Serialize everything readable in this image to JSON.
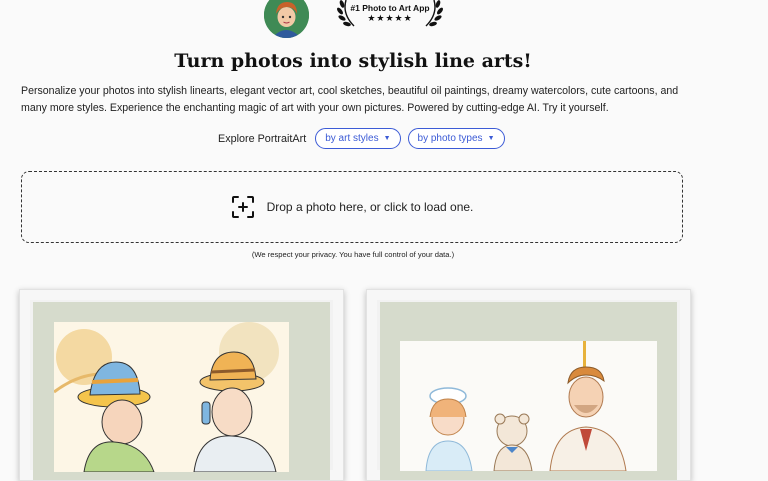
{
  "header": {
    "award_text": "#1 Photo to Art App",
    "award_stars": "★★★★★"
  },
  "hero": {
    "title": "Turn photos into stylish line arts!",
    "description": "Personalize your photos into stylish linearts, elegant vector art, cool sketches, beautiful oil paintings, dreamy watercolors, cute cartoons, and many more styles. Experience the enchanting magic of art with your own pictures. Powered by cutting-edge AI. Try it yourself."
  },
  "explore": {
    "label": "Explore PortraitArt",
    "options": [
      {
        "label": "by art styles"
      },
      {
        "label": "by photo types"
      }
    ]
  },
  "upload": {
    "prompt": "Drop a photo here, or click to load one.",
    "privacy_note": "(We respect your privacy. You have full control of your data.)"
  },
  "colors": {
    "accent": "#3c5bd6",
    "mat": "#d6dbcc"
  },
  "gallery": {
    "items": [
      {
        "icon": "lineart-children-hats"
      },
      {
        "icon": "lineart-family-teddy"
      }
    ]
  }
}
